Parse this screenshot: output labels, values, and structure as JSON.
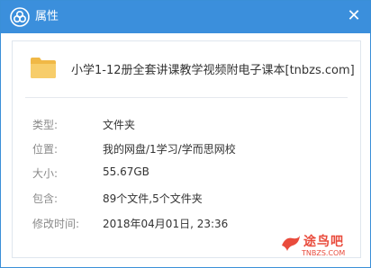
{
  "window": {
    "title": "属性",
    "close_icon": "close-icon"
  },
  "colors": {
    "titlebar": "#3b8fdc",
    "folder": "#f5c55a",
    "watermark": "#e94b3c"
  },
  "item": {
    "name": "小学1-12册全套讲课教学视频附电子课本[tnbzs.com]",
    "icon": "folder-icon"
  },
  "properties": [
    {
      "label": "类型:",
      "value": "文件夹"
    },
    {
      "label": "位置:",
      "value": "我的网盘/1学习/学而思网校"
    },
    {
      "label": "大小:",
      "value": "55.67GB"
    },
    {
      "label": "包含:",
      "value": "89个文件,5个文件夹"
    },
    {
      "label": "修改时间:",
      "value": "2018年04月01日, 23:36"
    }
  ],
  "watermark": {
    "name": "途鸟吧",
    "url": "TNBZS.COM"
  }
}
